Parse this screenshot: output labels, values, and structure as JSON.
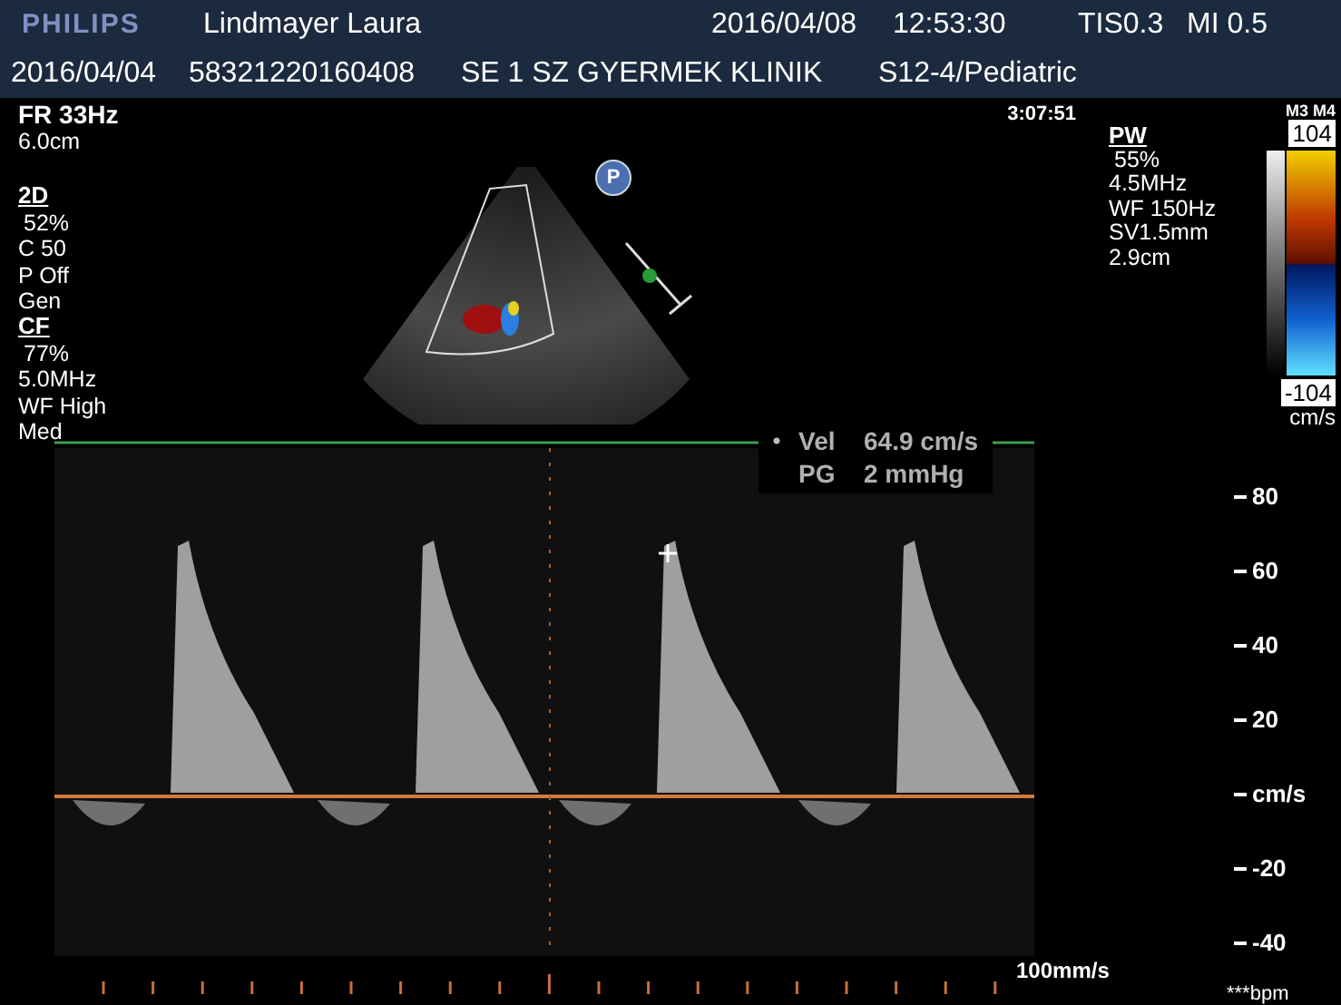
{
  "header": {
    "logo": "PHILIPS",
    "patient_name": "Lindmayer Laura",
    "date": "2016/04/08",
    "time": "12:53:30",
    "tis": "TIS0.3",
    "mi": "MI 0.5",
    "exam_date": "2016/04/04",
    "patient_id": "58321220160408",
    "institution": "SE 1 SZ GYERMEK KLINIK",
    "preset": "S12-4/Pediatric"
  },
  "left_panel": {
    "frame_rate": "FR 33Hz",
    "depth": "6.0cm",
    "sections": [
      {
        "heading": "2D",
        "values": [
          "52%",
          "C 50",
          "P Off",
          "Gen"
        ]
      },
      {
        "heading": "CF",
        "values": [
          "77%",
          "5.0MHz",
          "WF High",
          "Med"
        ]
      }
    ]
  },
  "image": {
    "orientation_marker": "P"
  },
  "clip_time": "3:07:51",
  "pw_panel": {
    "heading": "PW",
    "values": [
      "55%",
      "4.5MHz",
      "WF 150Hz",
      "SV1.5mm",
      "2.9cm"
    ]
  },
  "color_scale": {
    "label": "M3 M4",
    "max": "104",
    "min": "-104",
    "unit": "cm/s"
  },
  "measurement": [
    {
      "label": "Vel",
      "value": "64.9 cm/s"
    },
    {
      "label": "PG",
      "value": "2 mmHg"
    }
  ],
  "velocity_scale": [
    "80",
    "60",
    "40",
    "20",
    "cm/s",
    "-20",
    "-40"
  ],
  "sweep_speed": "100mm/s",
  "heart_rate": "***bpm"
}
